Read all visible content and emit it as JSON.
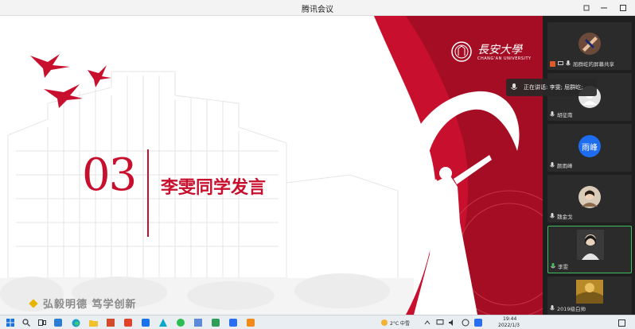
{
  "window": {
    "title": "腾讯会议"
  },
  "slide": {
    "section_number": "03",
    "section_title": "李雯同学发言",
    "motto": "弘毅明德  笃学创新",
    "university_cn": "長安大學",
    "university_en": "CHANG'AN UNIVERSITY",
    "watermark_text": "AN UNIVE"
  },
  "toast": {
    "text": "正在讲话: 李雯; 屈群屹;"
  },
  "participants": [
    {
      "name": "屈群屹的屏幕共享",
      "kind": "screen-share"
    },
    {
      "name": "胡征南",
      "kind": "avatar"
    },
    {
      "name": "颜雨峰",
      "kind": "initials",
      "initials": "雨峰"
    },
    {
      "name": "魏金戈",
      "kind": "photo"
    },
    {
      "name": "李雯",
      "kind": "photo",
      "active": true
    },
    {
      "name": "2019级白帅",
      "kind": "photo"
    }
  ],
  "taskbar": {
    "weather": "2°C 中雪",
    "time": "19:44",
    "date": "2022/1/3"
  },
  "colors": {
    "accent_red": "#c8102e",
    "active_green": "#3fbf62",
    "initials_blue": "#1e6cf0"
  }
}
